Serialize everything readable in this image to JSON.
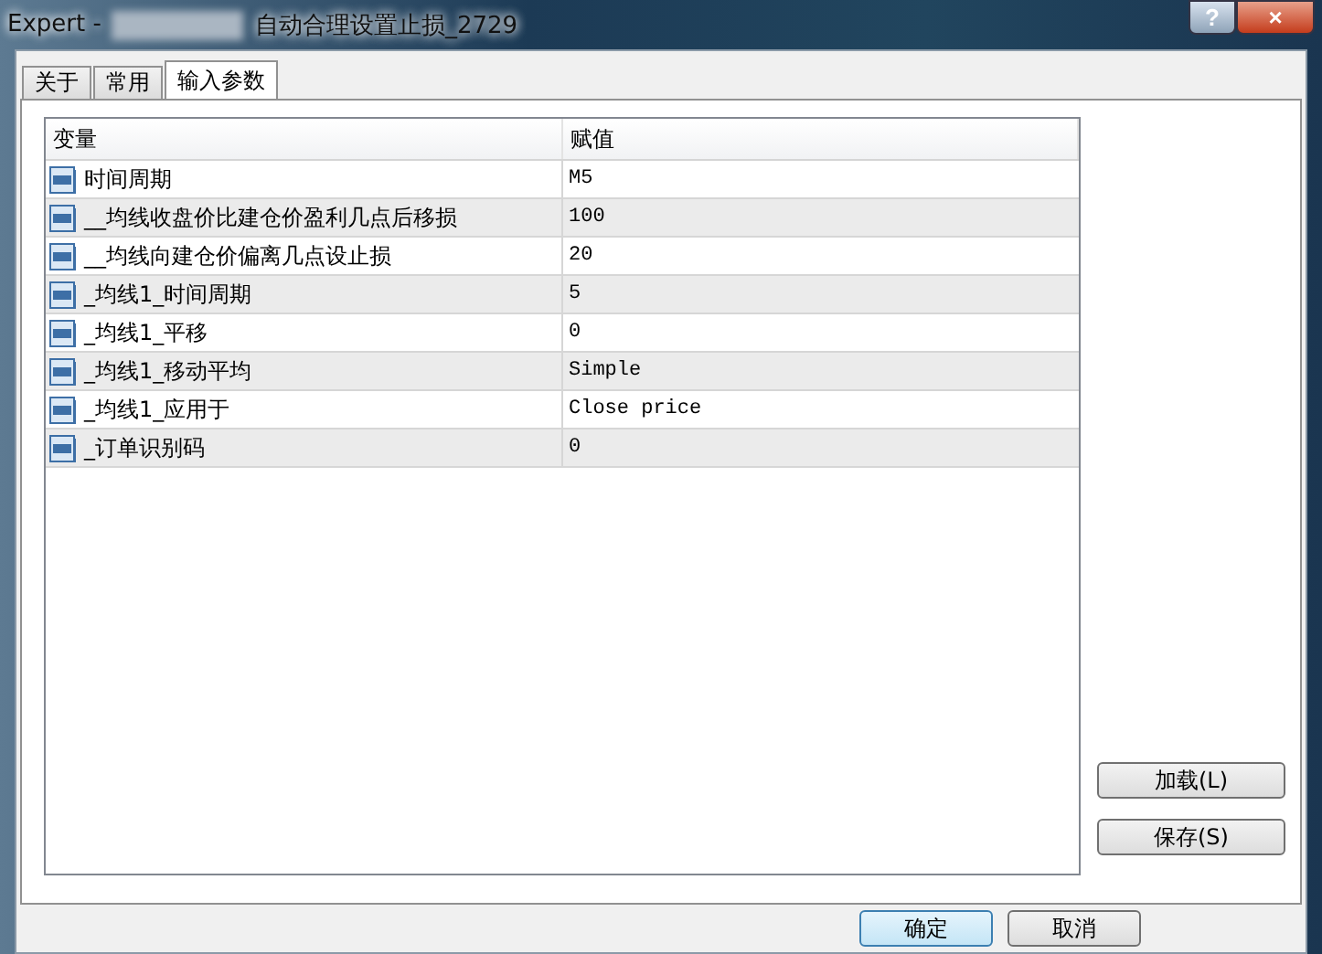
{
  "window": {
    "title_prefix": "Expert -",
    "title": "自动合理设置止损_2729",
    "buttons": [
      "?",
      "×"
    ]
  },
  "tabs": [
    {
      "label": "关于",
      "selected": false
    },
    {
      "label": "常用",
      "selected": false
    },
    {
      "label": "输入参数",
      "selected": true
    }
  ],
  "table": {
    "columns": [
      "变量",
      "赋值"
    ],
    "rows": [
      {
        "name": "时间周期",
        "value": "M5"
      },
      {
        "name": "__均线收盘价比建仓价盈利几点后移损",
        "value": "100"
      },
      {
        "name": "__均线向建仓价偏离几点设止损",
        "value": "20"
      },
      {
        "name": "_均线1_时间周期",
        "value": "5"
      },
      {
        "name": "_均线1_平移",
        "value": "0"
      },
      {
        "name": "_均线1_移动平均",
        "value": "Simple"
      },
      {
        "name": "_均线1_应用于",
        "value": "Close price"
      },
      {
        "name": "_订单识别码",
        "value": "0"
      }
    ]
  },
  "side_buttons": [
    "加载(L)",
    "保存(S)"
  ],
  "footer_buttons": [
    {
      "label": "确定",
      "default": true
    },
    {
      "label": "取消",
      "default": false
    }
  ]
}
